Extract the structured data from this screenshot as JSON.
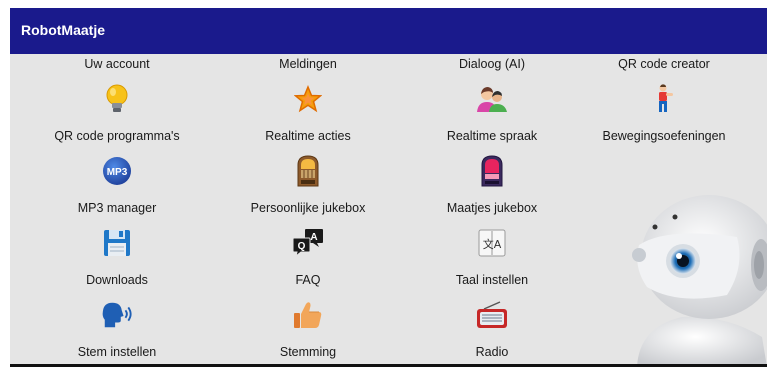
{
  "app": {
    "title": "RobotMaatje"
  },
  "top_row": [
    {
      "label": "Uw account"
    },
    {
      "label": "Meldingen"
    },
    {
      "label": "Dialoog (AI)"
    },
    {
      "label": "QR code creator"
    }
  ],
  "rows": [
    [
      {
        "label": "QR code programma's",
        "icon": "lightbulb-icon"
      },
      {
        "label": "Realtime acties",
        "icon": "star-icon"
      },
      {
        "label": "Realtime spraak",
        "icon": "people-chat-icon"
      },
      {
        "label": "Bewegingsoefeningen",
        "icon": "exercise-person-icon"
      }
    ],
    [
      {
        "label": "MP3 manager",
        "icon": "mp3-icon"
      },
      {
        "label": "Persoonlijke jukebox",
        "icon": "jukebox-icon"
      },
      {
        "label": "Maatjes jukebox",
        "icon": "jukebox-pink-icon"
      }
    ],
    [
      {
        "label": "Downloads",
        "icon": "floppy-disk-icon"
      },
      {
        "label": "FAQ",
        "icon": "qa-bubbles-icon"
      },
      {
        "label": "Taal instellen",
        "icon": "translate-icon"
      }
    ],
    [
      {
        "label": "Stem instellen",
        "icon": "speaking-head-icon"
      },
      {
        "label": "Stemming",
        "icon": "thumbs-up-icon"
      },
      {
        "label": "Radio",
        "icon": "radio-icon"
      }
    ]
  ],
  "icon_text": {
    "mp3": "MP3",
    "qa_q": "Q",
    "qa_a": "A",
    "translate": "文A"
  },
  "colors": {
    "appbar": "#1a1a8c",
    "background": "#e5e5e5"
  }
}
